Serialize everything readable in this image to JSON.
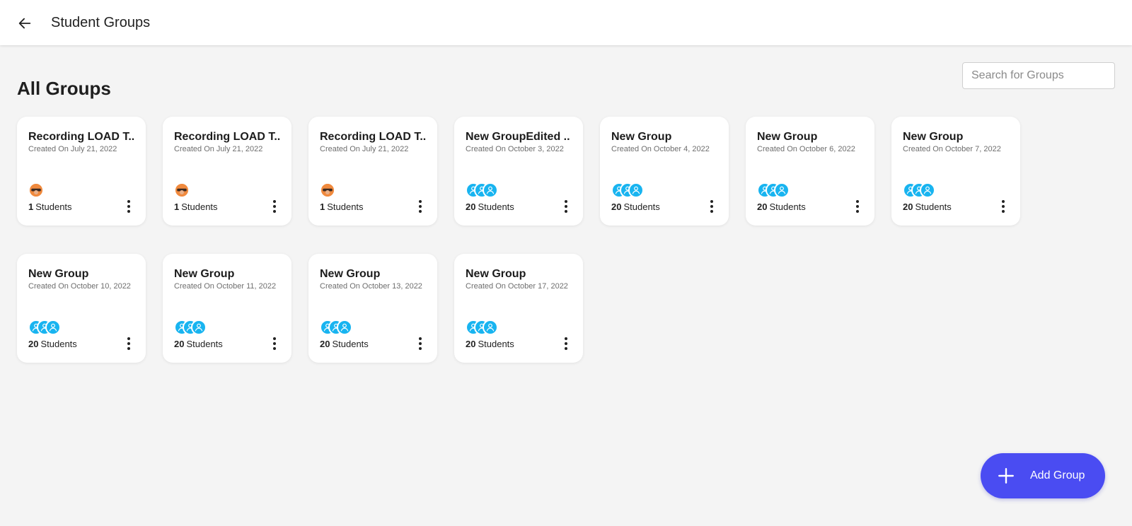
{
  "header": {
    "title": "Student Groups",
    "back_icon": "arrow-left-icon"
  },
  "main": {
    "section_title": "All Groups",
    "search": {
      "placeholder": "Search for Groups",
      "value": ""
    },
    "groups": [
      {
        "name": "Recording LOAD T..",
        "date": "Created On July 21, 2022",
        "count": "1",
        "count_label": "Students",
        "avatar": "photo"
      },
      {
        "name": "Recording LOAD T..",
        "date": "Created On July 21, 2022",
        "count": "1",
        "count_label": "Students",
        "avatar": "photo"
      },
      {
        "name": "Recording LOAD T..",
        "date": "Created On July 21, 2022",
        "count": "1",
        "count_label": "Students",
        "avatar": "photo"
      },
      {
        "name": "New GroupEdited ..",
        "date": "Created On October 3, 2022",
        "count": "20",
        "count_label": "Students",
        "avatar": "group"
      },
      {
        "name": "New Group",
        "date": "Created On October 4, 2022",
        "count": "20",
        "count_label": "Students",
        "avatar": "group"
      },
      {
        "name": "New Group",
        "date": "Created On October 6, 2022",
        "count": "20",
        "count_label": "Students",
        "avatar": "group"
      },
      {
        "name": "New Group",
        "date": "Created On October 7, 2022",
        "count": "20",
        "count_label": "Students",
        "avatar": "group"
      },
      {
        "name": "New Group",
        "date": "Created On October 10, 2022",
        "count": "20",
        "count_label": "Students",
        "avatar": "group"
      },
      {
        "name": "New Group",
        "date": "Created On October 11, 2022",
        "count": "20",
        "count_label": "Students",
        "avatar": "group"
      },
      {
        "name": "New Group",
        "date": "Created On October 13, 2022",
        "count": "20",
        "count_label": "Students",
        "avatar": "group"
      },
      {
        "name": "New Group",
        "date": "Created On October 17, 2022",
        "count": "20",
        "count_label": "Students",
        "avatar": "group"
      }
    ]
  },
  "fab": {
    "label": "Add Group",
    "icon": "plus-icon"
  },
  "colors": {
    "accent": "#4a4cf2",
    "avatar_blue": "#18b4f0",
    "avatar_photo": "#f08a3e",
    "background": "#f4f4f4"
  }
}
